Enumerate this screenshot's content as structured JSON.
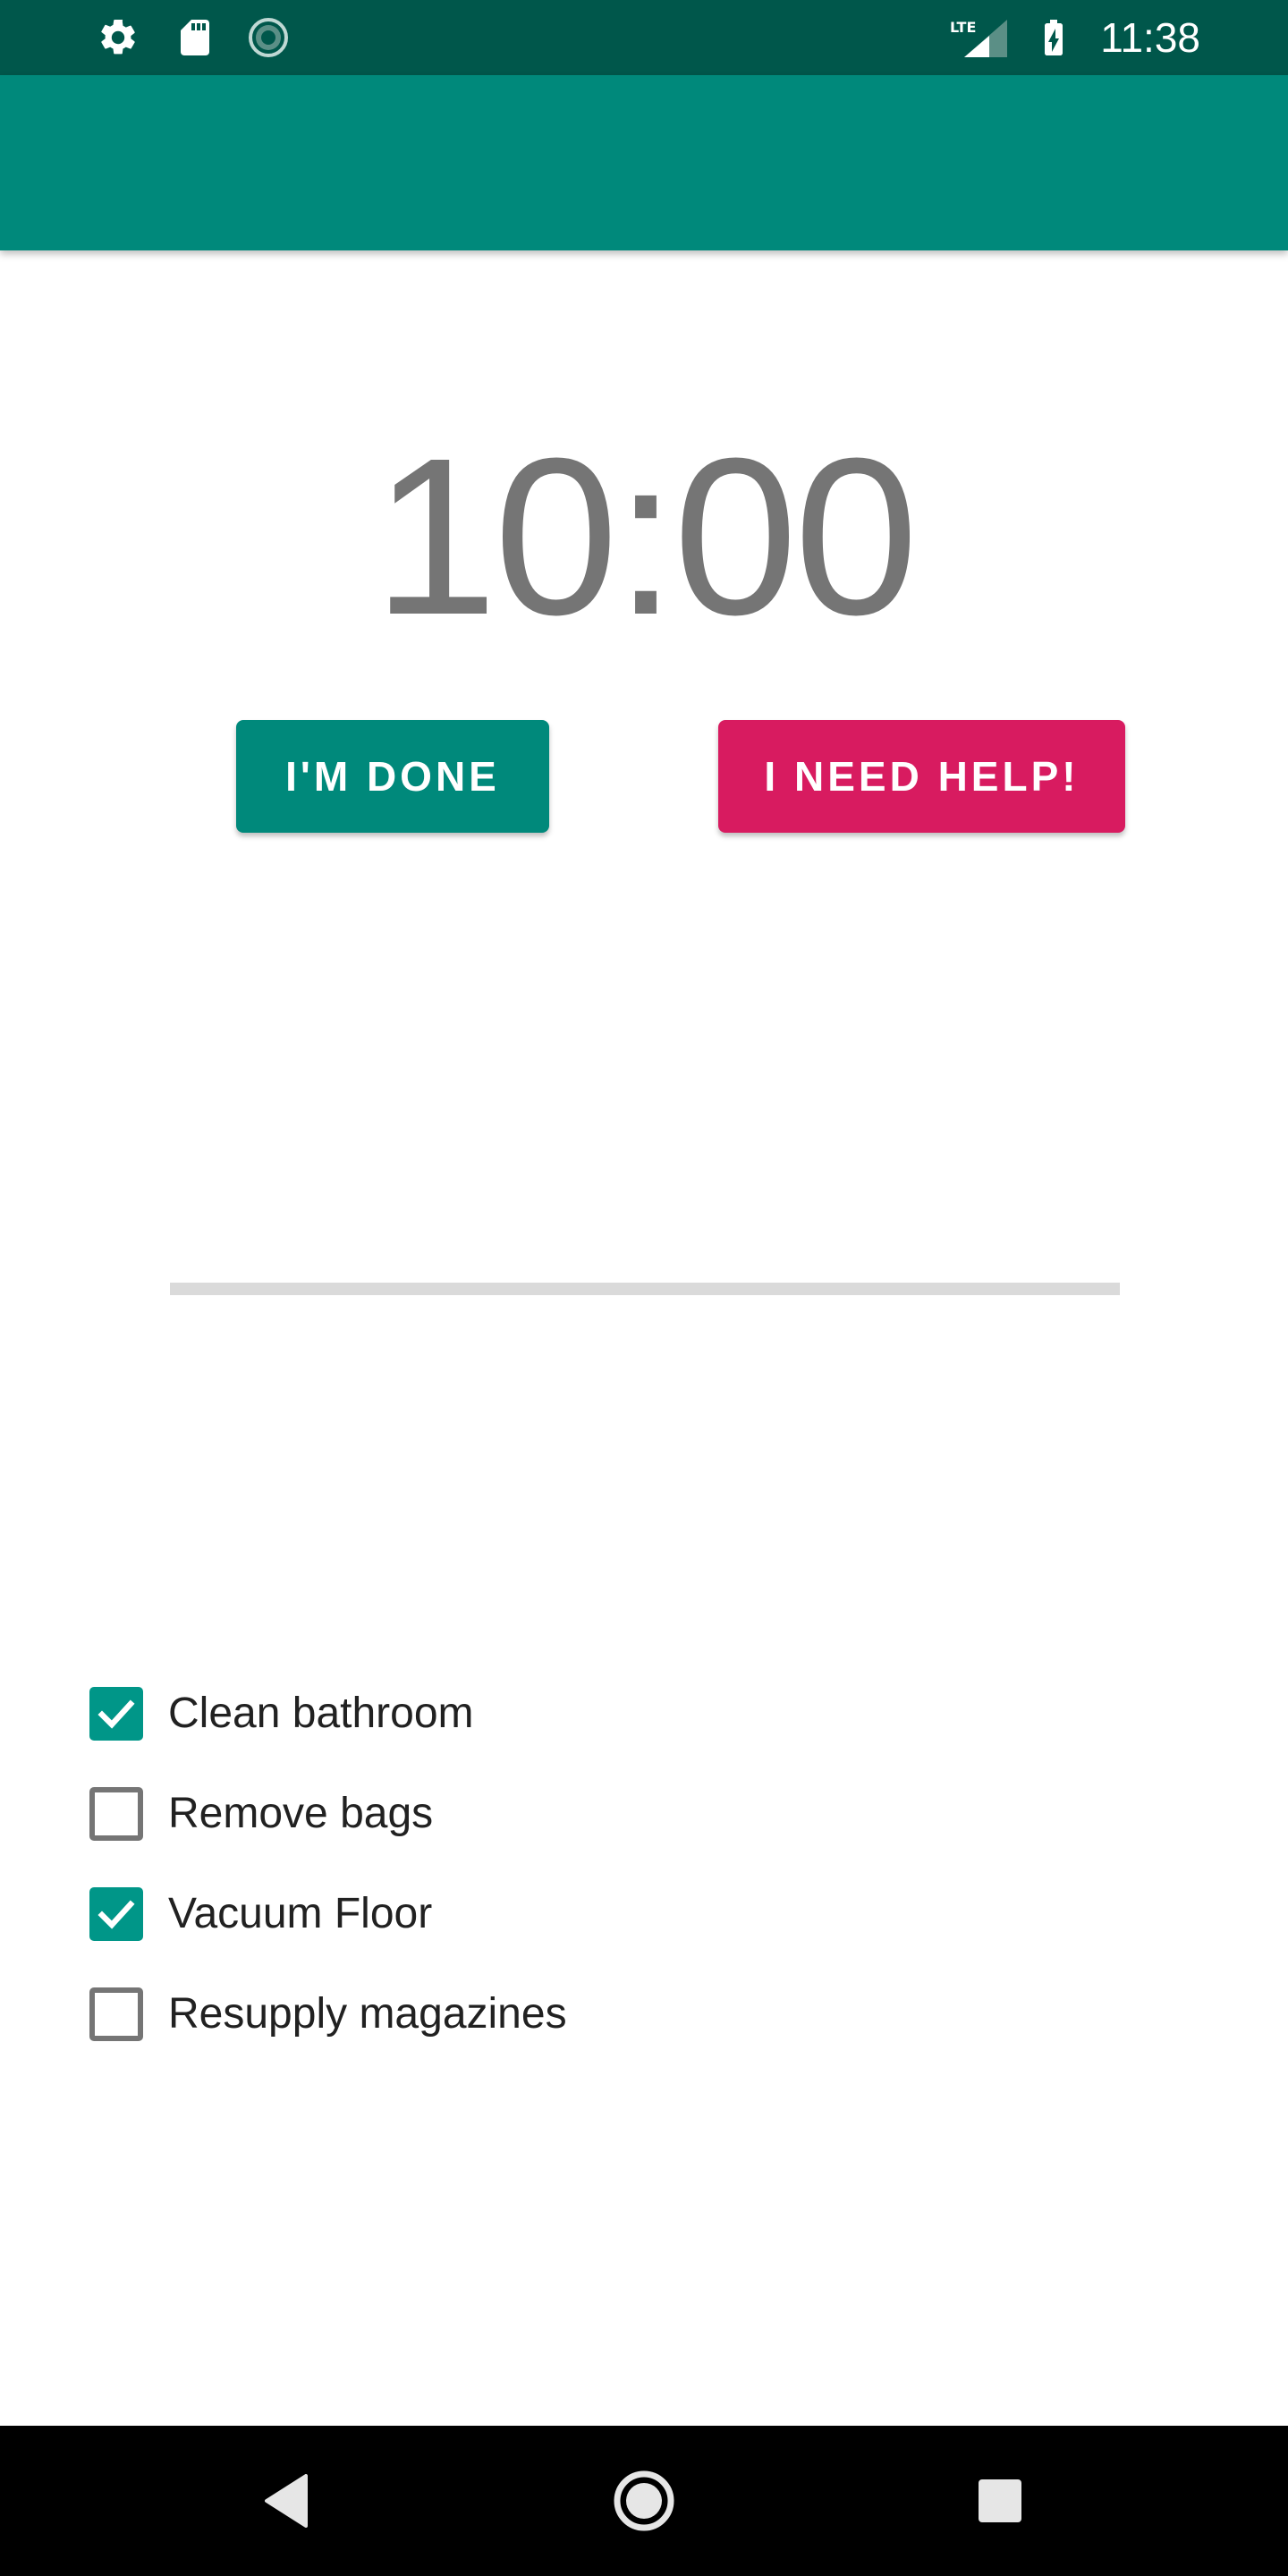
{
  "status_bar": {
    "time": "11:38",
    "icons": [
      "gear-icon",
      "sd-card-icon",
      "sync-icon",
      "lte-signal-icon",
      "battery-charging-icon"
    ],
    "network_label": "LTE"
  },
  "colors": {
    "status_bar": "#00574b",
    "app_bar": "#00897b",
    "done_button": "#00897b",
    "help_button": "#d81b60",
    "checkbox_checked": "#009688",
    "timer_text": "#757575"
  },
  "timer": {
    "display": "10:00"
  },
  "buttons": {
    "done_label": "I'M DONE",
    "help_label": "I NEED HELP!"
  },
  "progress": {
    "value": 0
  },
  "checklist": {
    "items": [
      {
        "label": "Clean bathroom",
        "checked": true
      },
      {
        "label": "Remove bags",
        "checked": false
      },
      {
        "label": "Vacuum Floor",
        "checked": true
      },
      {
        "label": "Resupply magazines",
        "checked": false
      }
    ]
  },
  "nav_bar": {
    "icons": [
      "back-icon",
      "home-icon",
      "recents-icon"
    ]
  }
}
